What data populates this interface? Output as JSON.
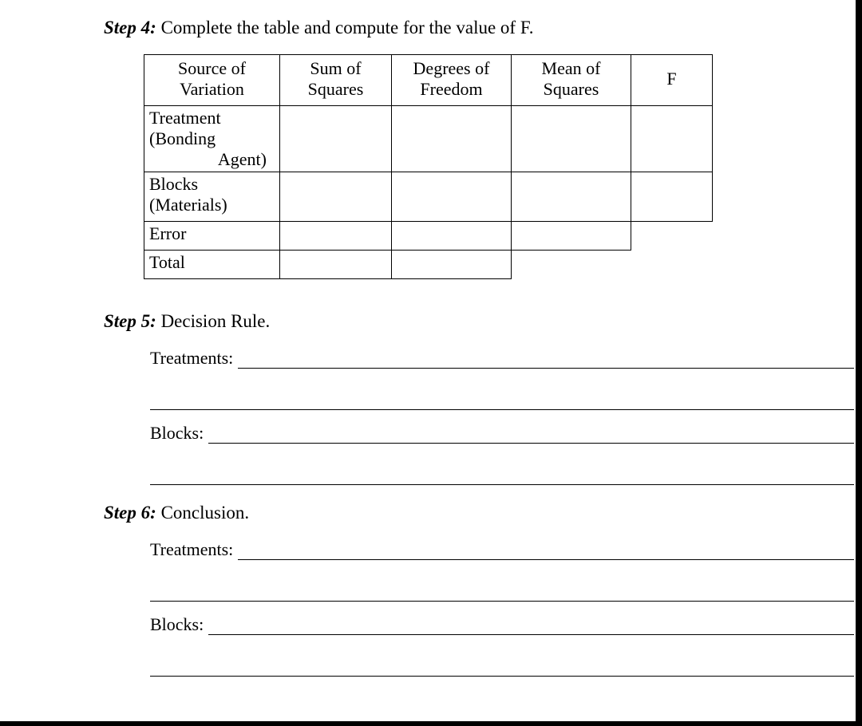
{
  "step4": {
    "label": "Step 4:",
    "text": " Complete the table and compute for the value of F."
  },
  "table": {
    "headers": {
      "source": "Source of\nVariation",
      "ss": "Sum of\nSquares",
      "df": "Degrees of\nFreedom",
      "ms": "Mean of\nSquares",
      "f": "F"
    },
    "rows": {
      "treatment_line1": "Treatment",
      "treatment_line2": "(Bonding",
      "treatment_line3": "Agent)",
      "blocks_line1": "Blocks",
      "blocks_line2": "(Materials)",
      "error": "Error",
      "total": "Total"
    }
  },
  "step5": {
    "label": "Step 5:",
    "text": " Decision Rule.",
    "treatments_label": "Treatments:",
    "blocks_label": "Blocks:"
  },
  "step6": {
    "label": "Step 6:",
    "text": " Conclusion.",
    "treatments_label": "Treatments:",
    "blocks_label": "Blocks:"
  }
}
